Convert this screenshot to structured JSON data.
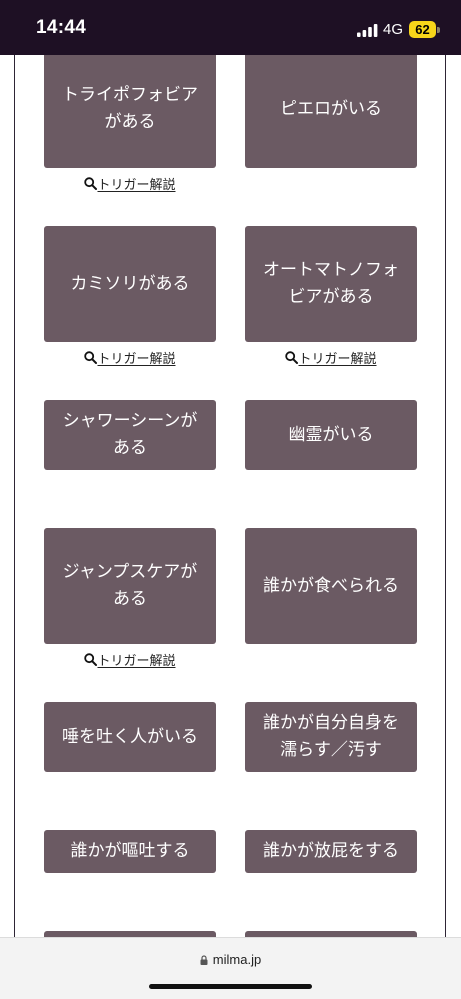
{
  "status_bar": {
    "time": "14:44",
    "network": "4G",
    "battery": "62"
  },
  "colors": {
    "status_bg": "#1e1024",
    "card_bg": "#6b5a63",
    "card_text": "#ffffff",
    "link_text": "#222222",
    "battery_bg": "#f7d51a"
  },
  "icons": {
    "signal": "cellular-signal-icon",
    "search": "magnifier-icon",
    "lock": "lock-icon"
  },
  "trigger_link_label": "トリガー解説",
  "cards": [
    {
      "label": "トライポフォビアがある"
    },
    {
      "label": "ピエロがいる"
    },
    {
      "label": "カミソリがある"
    },
    {
      "label": "オートマトノフォビアがある"
    },
    {
      "label": "シャワーシーンがある"
    },
    {
      "label": "幽霊がいる"
    },
    {
      "label": "ジャンプスケアがある"
    },
    {
      "label": "誰かが食べられる"
    },
    {
      "label": "唾を吐く人がいる"
    },
    {
      "label": "誰かが自分自身を濡らす／汚す"
    },
    {
      "label": "誰かが嘔吐する"
    },
    {
      "label": "誰かが放屁をする"
    }
  ],
  "browser_bar": {
    "domain": "milma.jp"
  }
}
